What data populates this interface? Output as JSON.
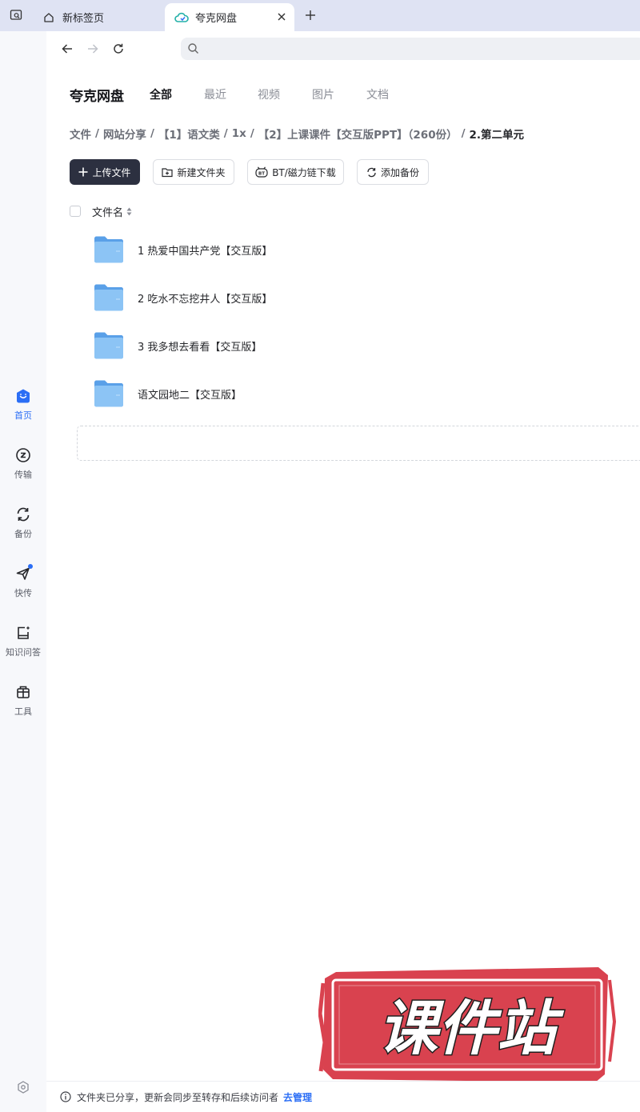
{
  "browser": {
    "tabs": [
      {
        "title": "新标签页"
      },
      {
        "title": "夸克网盘"
      }
    ]
  },
  "app": {
    "logo": "夸克网盘",
    "filter_tabs": [
      "全部",
      "最近",
      "视频",
      "图片",
      "文档"
    ],
    "active_filter": "全部"
  },
  "breadcrumb": [
    "文件",
    "网站分享",
    "【1】语文类",
    "1x",
    "【2】上课课件【交互版PPT】（260份）",
    "2.第二单元"
  ],
  "actions": {
    "upload": "上传文件",
    "new_folder": "新建文件夹",
    "bt_download": "BT/磁力链下载",
    "add_backup": "添加备份"
  },
  "list": {
    "column_name": "文件名",
    "files": [
      {
        "name": "1 热爱中国共产党【交互版】"
      },
      {
        "name": "2 吃水不忘挖井人【交互版】"
      },
      {
        "name": "3 我多想去看看【交互版】"
      },
      {
        "name": "语文园地二【交互版】"
      }
    ]
  },
  "sidebar": {
    "items": [
      {
        "label": "首页",
        "icon": "home-face-icon"
      },
      {
        "label": "传输",
        "icon": "transfer-icon"
      },
      {
        "label": "备份",
        "icon": "backup-icon"
      },
      {
        "label": "快传",
        "icon": "quick-send-icon"
      },
      {
        "label": "知识问答",
        "icon": "knowledge-qa-icon"
      },
      {
        "label": "工具",
        "icon": "toolbox-icon"
      }
    ]
  },
  "footer": {
    "message": "文件夹已分享，更新会同步至转存和后续访问者",
    "link": "去管理"
  },
  "watermark": {
    "text": "课件站"
  },
  "colors": {
    "accent": "#2b6ef5",
    "primary_button": "#2c3040",
    "watermark_red": "#d9424f",
    "folder_blue": "#6fb2f0"
  }
}
